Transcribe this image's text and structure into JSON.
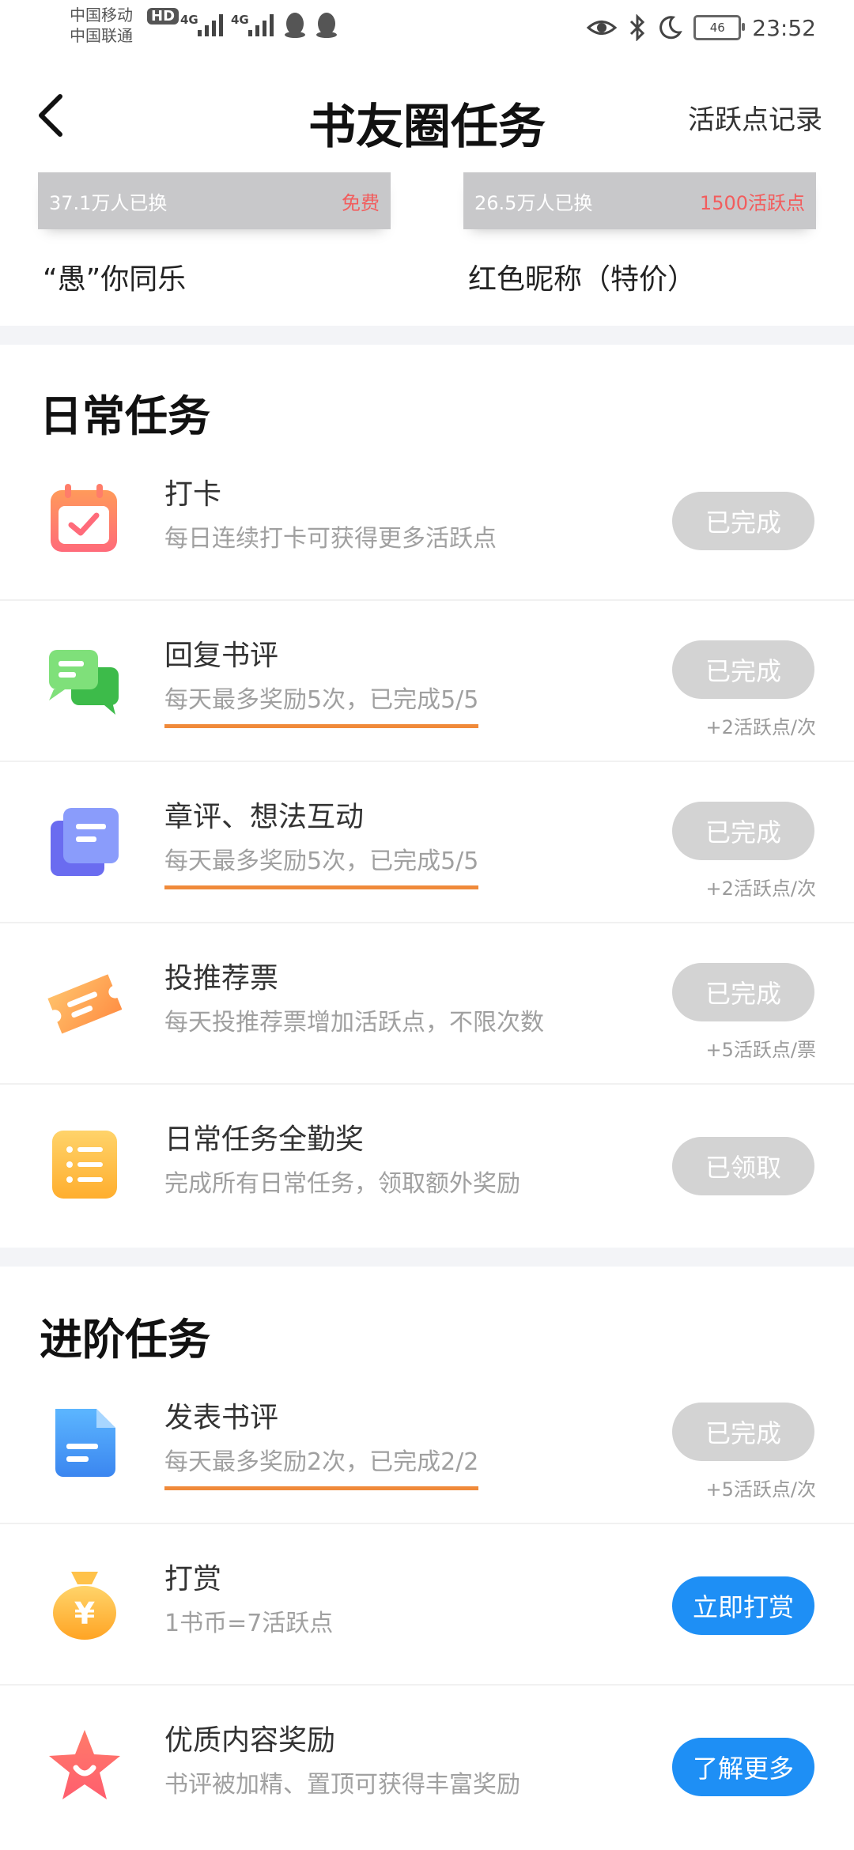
{
  "status_bar": {
    "carrier1": "中国移动",
    "carrier2": "中国联通",
    "hd": "HD",
    "net1": "4G",
    "net2": "4G",
    "battery": "46",
    "time": "23:52"
  },
  "header": {
    "title": "书友圈任务",
    "record_link": "活跃点记录"
  },
  "rewards": [
    {
      "count": "37.1万人已换",
      "price": "免费",
      "name": "“愚”你同乐"
    },
    {
      "count": "26.5万人已换",
      "price": "1500活跃点",
      "name": "红色昵称（特价）"
    }
  ],
  "daily": {
    "title": "日常任务",
    "tasks": [
      {
        "title": "打卡",
        "desc": "每日连续打卡可获得更多活跃点",
        "button": "已完成",
        "sub": ""
      },
      {
        "title": "回复书评",
        "desc": "每天最多奖励5次，已完成5/5",
        "button": "已完成",
        "sub": "+2活跃点/次"
      },
      {
        "title": "章评、想法互动",
        "desc": "每天最多奖励5次，已完成5/5",
        "button": "已完成",
        "sub": "+2活跃点/次"
      },
      {
        "title": "投推荐票",
        "desc": "每天投推荐票增加活跃点，不限次数",
        "button": "已完成",
        "sub": "+5活跃点/票"
      },
      {
        "title": "日常任务全勤奖",
        "desc": "完成所有日常任务，领取额外奖励",
        "button": "已领取",
        "sub": ""
      }
    ]
  },
  "advanced": {
    "title": "进阶任务",
    "tasks": [
      {
        "title": "发表书评",
        "desc": "每天最多奖励2次，已完成2/2",
        "button": "已完成",
        "sub": "+5活跃点/次"
      },
      {
        "title": "打赏",
        "desc": "1书币=7活跃点",
        "button": "立即打赏",
        "sub": ""
      },
      {
        "title": "优质内容奖励",
        "desc": "书评被加精、置顶可获得丰富奖励",
        "button": "了解更多",
        "sub": ""
      }
    ]
  },
  "colors": {
    "accent_blue": "#1e8ff5",
    "done_gray": "#d3d3d3",
    "progress_orange": "#f08a3a",
    "price_red": "#f25d5d"
  },
  "icons": {
    "checkin": "calendar-check-icon",
    "reply": "chat-bubbles-icon",
    "chapter_comment": "document-stack-icon",
    "vote": "ticket-icon",
    "attendance": "list-icon",
    "post_review": "document-icon",
    "tip": "money-bag-icon",
    "quality": "star-icon"
  }
}
